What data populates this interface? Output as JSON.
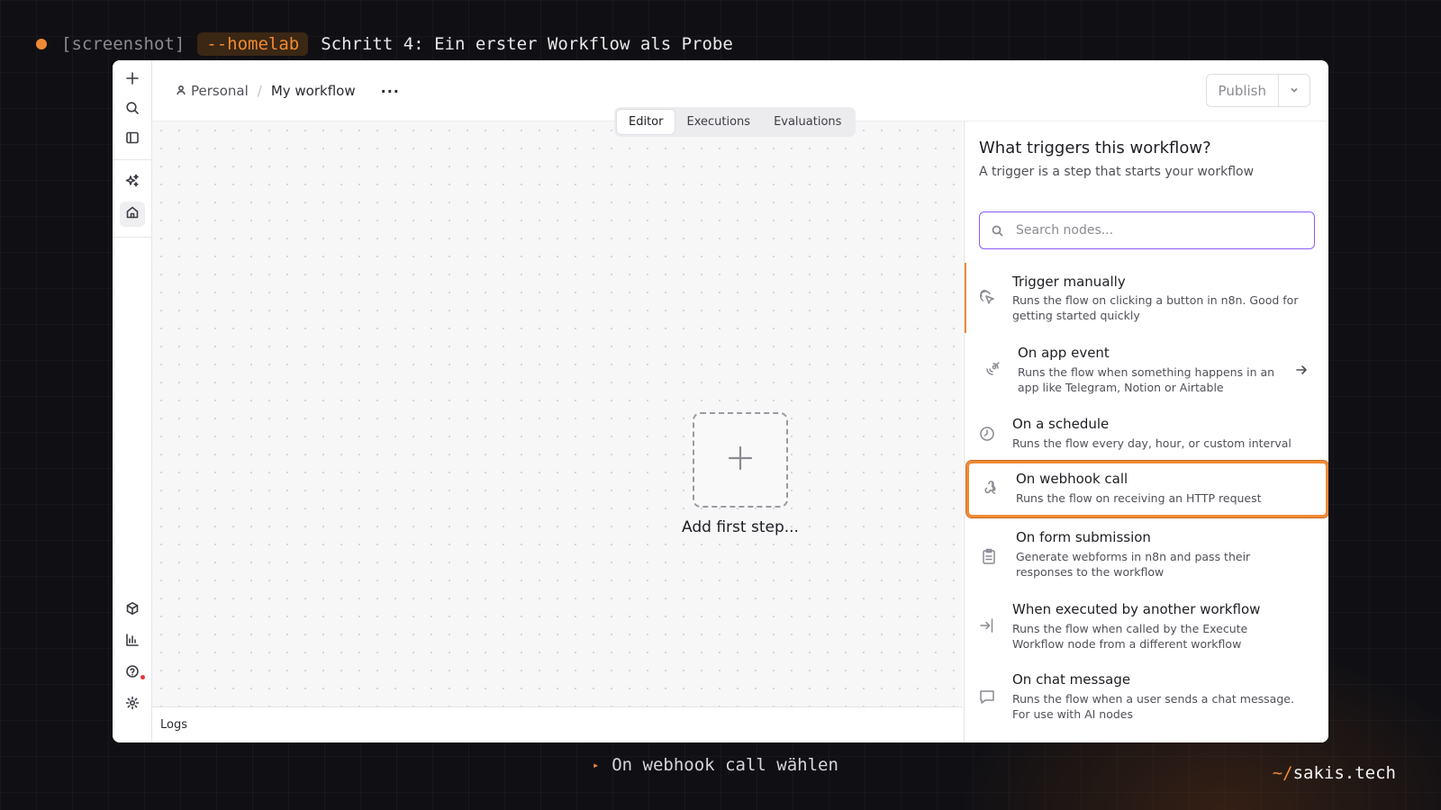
{
  "caption": {
    "tag": "[screenshot]",
    "flag": "--homelab",
    "title": "Schritt 4: Ein erster Workflow als Probe"
  },
  "rail": {
    "icons": [
      "plus-icon",
      "search-icon",
      "sidebar-icon",
      "sparkles-icon",
      "home-icon",
      "templates-icon",
      "insights-icon",
      "help-icon",
      "settings-icon"
    ]
  },
  "header": {
    "personal": "Personal",
    "workflow_name": "My workflow",
    "more": "···",
    "publish_label": "Publish"
  },
  "tabs": [
    "Editor",
    "Executions",
    "Evaluations"
  ],
  "canvas": {
    "add_first_step": "Add first step..."
  },
  "logs": {
    "label": "Logs"
  },
  "panel": {
    "title": "What triggers this workflow?",
    "subtitle": "A trigger is a step that starts your workflow",
    "search_placeholder": "Search nodes...",
    "items": [
      {
        "title": "Trigger manually",
        "desc": "Runs the flow on clicking a button in n8n. Good for getting started quickly",
        "icon": "pointer-click-icon"
      },
      {
        "title": "On app event",
        "desc": "Runs the flow when something happens in an app like Telegram, Notion or Airtable",
        "icon": "satellite-icon"
      },
      {
        "title": "On a schedule",
        "desc": "Runs the flow every day, hour, or custom interval",
        "icon": "clock-icon"
      },
      {
        "title": "On webhook call",
        "desc": "Runs the flow on receiving an HTTP request",
        "icon": "webhook-icon"
      },
      {
        "title": "On form submission",
        "desc": "Generate webforms in n8n and pass their responses to the workflow",
        "icon": "clipboard-icon"
      },
      {
        "title": "When executed by another workflow",
        "desc": "Runs the flow when called by the Execute Workflow node from a different workflow",
        "icon": "sign-in-icon"
      },
      {
        "title": "On chat message",
        "desc": "Runs the flow when a user sends a chat message. For use with AI nodes",
        "icon": "chat-icon"
      }
    ]
  },
  "bottom": {
    "marker": "▸",
    "text": "On webhook call wählen"
  },
  "brand": {
    "prefix": "~/",
    "name": "sakis.tech"
  },
  "colors": {
    "accent": "#f08a35",
    "search_focus": "#8b5cf6",
    "background": "#101014"
  }
}
